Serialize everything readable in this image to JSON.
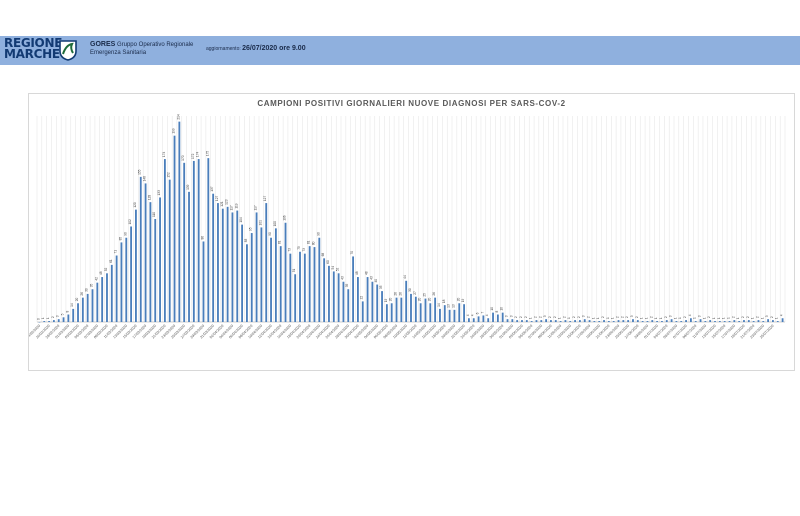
{
  "header": {
    "logo_text_line1": "REGIONE",
    "logo_text_line2": "MARCHE",
    "org_name": "GORES",
    "org_desc_line1": "Gruppo Operativo Regionale",
    "org_desc_line2": "Emergenza Sanitaria",
    "update_label": "aggiornamento:",
    "update_value": "26/07/2020 ore 9.00",
    "band_color": "#8fb0de",
    "logo_color": "#123a73"
  },
  "chart_data": {
    "type": "bar",
    "title": "CAMPIONI POSITIVI GIORNALIERI NUOVE DIAGNOSI PER SARS-COV-2",
    "xlabel": "",
    "ylabel": "",
    "ylim": [
      0,
      220
    ],
    "grid": "vertical",
    "bar_color": "#4a7ebb",
    "categories": [
      "ENTRO IL 24/02/2020",
      "25/02/2020",
      "26/02/2020",
      "27/02/2020",
      "28/02/2020",
      "29/02/2020",
      "01/03/2020",
      "02/03/2020",
      "03/03/2020",
      "04/03/2020",
      "05/03/2020",
      "06/03/2020",
      "07/03/2020",
      "08/03/2020",
      "09/03/2020",
      "10/03/2020",
      "11/03/2020",
      "12/03/2020",
      "13/03/2020",
      "14/03/2020",
      "15/03/2020",
      "16/03/2020",
      "17/03/2020",
      "18/03/2020",
      "19/03/2020",
      "20/03/2020",
      "21/03/2020",
      "22/03/2020",
      "23/03/2020",
      "24/03/2020",
      "25/03/2020",
      "26/03/2020",
      "27/03/2020",
      "28/03/2020",
      "29/03/2020",
      "30/03/2020",
      "31/03/2020",
      "01/04/2020",
      "02/04/2020",
      "03/04/2020",
      "04/04/2020",
      "05/04/2020",
      "06/04/2020",
      "07/04/2020",
      "08/04/2020",
      "09/04/2020",
      "10/04/2020",
      "11/04/2020",
      "12/04/2020",
      "13/04/2020",
      "14/04/2020",
      "15/04/2020",
      "16/04/2020",
      "17/04/2020",
      "18/04/2020",
      "19/04/2020",
      "20/04/2020",
      "21/04/2020",
      "22/04/2020",
      "23/04/2020",
      "24/04/2020",
      "25/04/2020",
      "26/04/2020",
      "27/04/2020",
      "28/04/2020",
      "29/04/2020",
      "30/04/2020",
      "01/05/2020",
      "02/05/2020",
      "03/05/2020",
      "04/05/2020",
      "05/05/2020",
      "06/05/2020",
      "07/05/2020",
      "08/05/2020",
      "09/05/2020",
      "10/05/2020",
      "11/05/2020",
      "12/05/2020",
      "13/05/2020",
      "14/05/2020",
      "15/05/2020",
      "16/05/2020",
      "17/05/2020",
      "18/05/2020",
      "19/05/2020",
      "20/05/2020",
      "21/05/2020",
      "22/05/2020",
      "23/05/2020",
      "24/05/2020",
      "25/05/2020",
      "26/05/2020",
      "27/05/2020",
      "28/05/2020",
      "29/05/2020",
      "30/05/2020",
      "31/05/2020",
      "01/06/2020",
      "02/06/2020",
      "03/06/2020",
      "04/06/2020",
      "05/06/2020",
      "06/06/2020",
      "07/06/2020",
      "08/06/2020",
      "09/06/2020",
      "10/06/2020",
      "11/06/2020",
      "12/06/2020",
      "13/06/2020",
      "14/06/2020",
      "15/06/2020",
      "16/06/2020",
      "17/06/2020",
      "18/06/2020",
      "19/06/2020",
      "20/06/2020",
      "21/06/2020",
      "22/06/2020",
      "23/06/2020",
      "24/06/2020",
      "25/06/2020",
      "26/06/2020",
      "27/06/2020",
      "28/06/2020",
      "29/06/2020",
      "30/06/2020",
      "01/07/2020",
      "02/07/2020",
      "03/07/2020",
      "04/07/2020",
      "05/07/2020",
      "06/07/2020",
      "07/07/2020",
      "08/07/2020",
      "09/07/2020",
      "10/07/2020",
      "11/07/2020",
      "12/07/2020",
      "13/07/2020",
      "14/07/2020",
      "15/07/2020",
      "16/07/2020",
      "17/07/2020",
      "18/07/2020",
      "19/07/2020",
      "20/07/2020",
      "21/07/2020",
      "22/07/2020",
      "23/07/2020",
      "24/07/2020",
      "25/07/2020"
    ],
    "values": [
      0,
      1,
      1,
      2,
      3,
      5,
      8,
      14,
      20,
      26,
      30,
      35,
      42,
      48,
      52,
      61,
      71,
      85,
      90,
      102,
      120,
      155,
      148,
      128,
      110,
      133,
      174,
      152,
      199,
      214,
      170,
      139,
      172,
      174,
      86,
      175,
      137,
      127,
      121,
      123,
      117,
      119,
      104,
      83,
      95,
      117,
      101,
      127,
      90,
      100,
      81,
      106,
      73,
      51,
      75,
      73,
      81,
      80,
      90,
      68,
      60,
      54,
      52,
      43,
      35,
      70,
      48,
      22,
      48,
      43,
      40,
      33,
      19,
      20,
      26,
      26,
      44,
      30,
      27,
      20,
      25,
      20,
      26,
      14,
      18,
      13,
      13,
      20,
      19,
      4,
      4,
      6,
      7,
      4,
      10,
      8,
      10,
      3,
      3,
      2,
      2,
      2,
      1,
      2,
      2,
      3,
      2,
      2,
      1,
      2,
      1,
      2,
      2,
      3,
      2,
      1,
      1,
      2,
      1,
      1,
      2,
      2,
      2,
      3,
      2,
      1,
      1,
      2,
      1,
      1,
      2,
      3,
      1,
      1,
      2,
      4,
      1,
      3,
      1,
      2,
      1,
      1,
      1,
      1,
      2,
      1,
      2,
      2,
      1,
      2,
      1,
      3,
      2,
      1,
      4
    ]
  }
}
